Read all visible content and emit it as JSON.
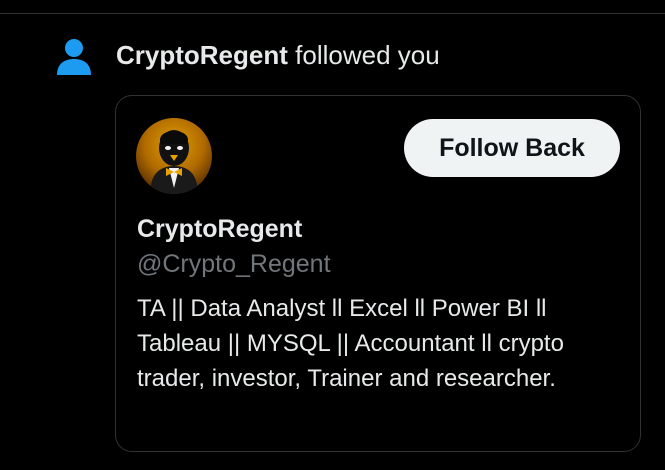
{
  "notification": {
    "icon": "person-icon",
    "icon_color": "#1d9bf0",
    "user": "CryptoRegent",
    "action": " followed you"
  },
  "profile_card": {
    "avatar": "penguin-avatar",
    "follow_button_label": "Follow Back",
    "display_name": "CryptoRegent",
    "handle": "@Crypto_Regent",
    "bio": "TA || Data Analyst ll Excel ll Power BI ll Tableau || MYSQL || Accountant ll crypto trader, investor, Trainer and researcher."
  }
}
